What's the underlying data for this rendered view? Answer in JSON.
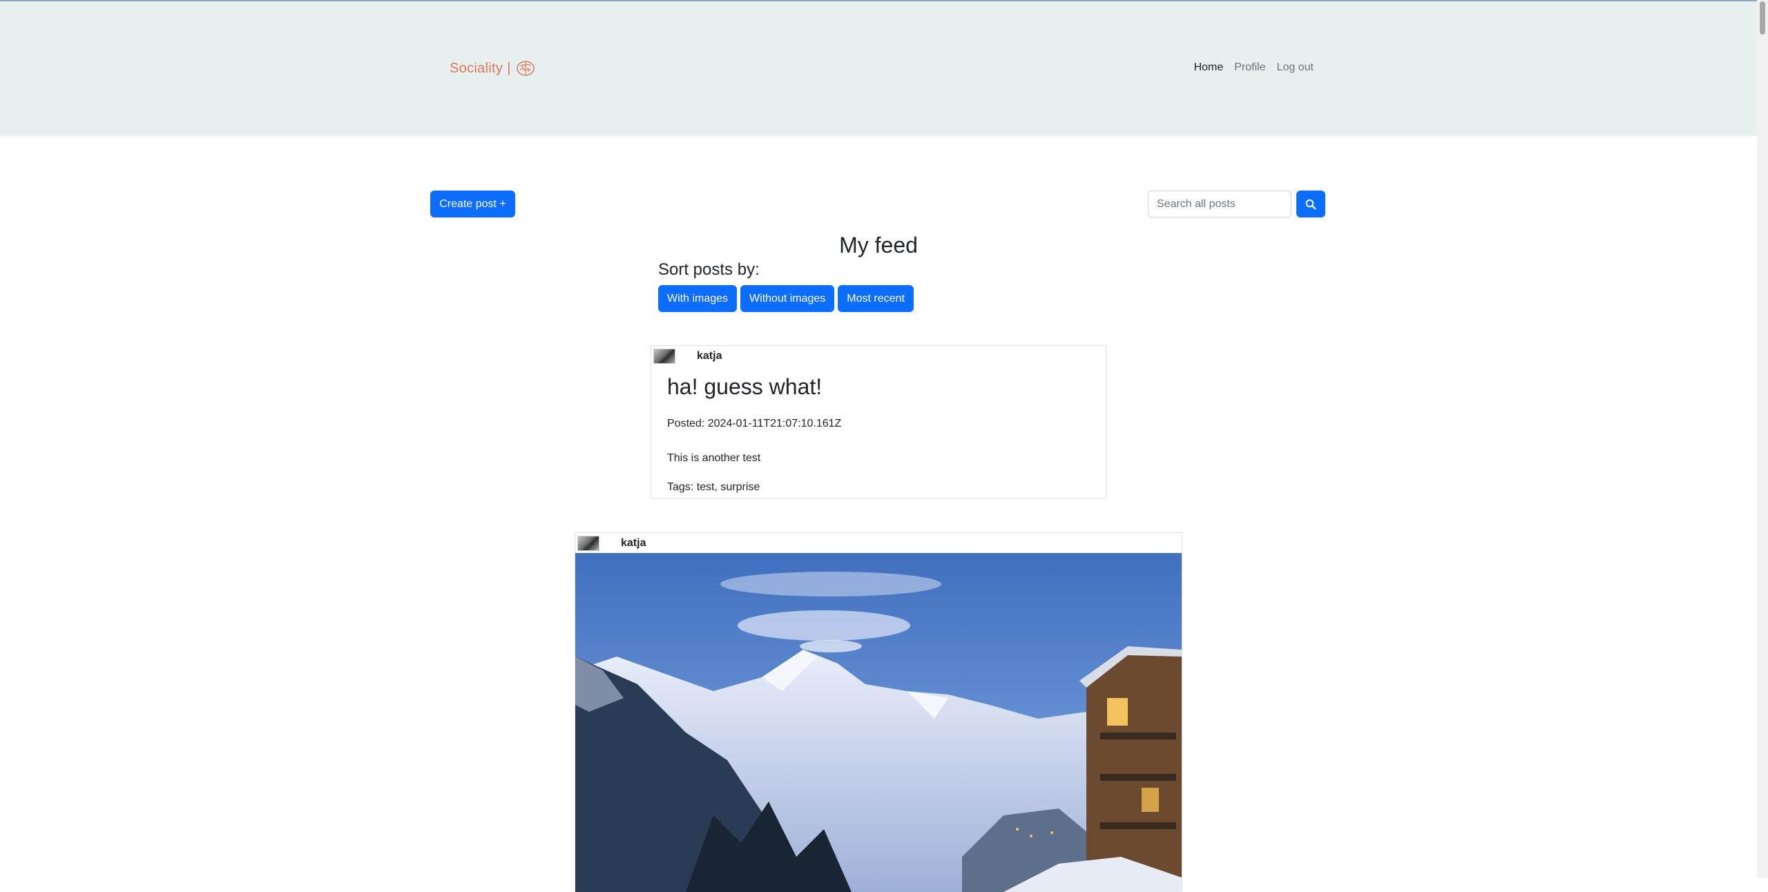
{
  "header": {
    "brand": "Sociality",
    "brand_separator": "|",
    "logo_icon": "brain-logo",
    "nav": [
      {
        "label": "Home",
        "active": true
      },
      {
        "label": "Profile",
        "active": false
      },
      {
        "label": "Log out",
        "active": false
      }
    ]
  },
  "toolbar": {
    "create_label": "Create post +",
    "search_placeholder": "Search all posts",
    "search_icon": "search-icon"
  },
  "feed": {
    "title": "My feed",
    "sort_label": "Sort posts by:",
    "sort_buttons": [
      "With images",
      "Without images",
      "Most recent"
    ]
  },
  "posts": [
    {
      "username": "katja",
      "title": "ha! guess what!",
      "date": "Posted: 2024-01-11T21:07:10.161Z",
      "text": "This is another test",
      "tags": "Tags: test, surprise"
    },
    {
      "username": "katja",
      "image": "mountain-landscape-photo"
    }
  ],
  "colors": {
    "primary": "#0d6efd",
    "header_bg": "#e8f0ef",
    "brand": "#d9785a"
  }
}
